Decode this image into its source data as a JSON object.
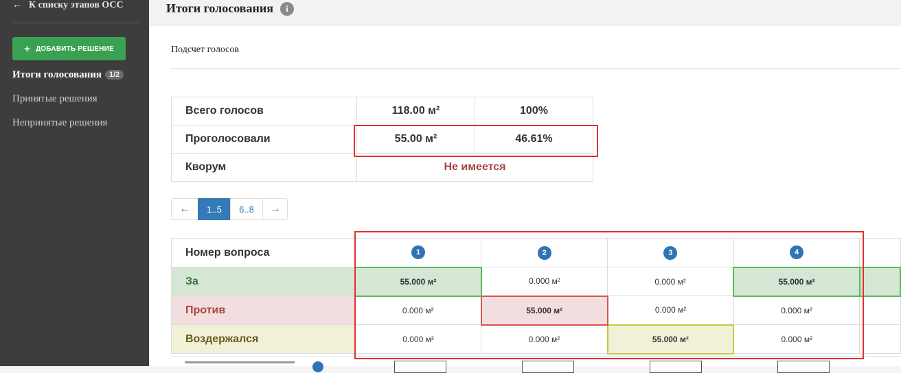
{
  "sidebar": {
    "back_arrow": "←",
    "back_label": "К списку этапов ОСС",
    "add_plus": "+",
    "add_label": "ДОБАВИТЬ РЕШЕНИЕ",
    "nav": [
      {
        "label": "Итоги голосования",
        "badge": "1/2",
        "active": true
      },
      {
        "label": "Принятые решения"
      },
      {
        "label": "Непринятые решения"
      }
    ]
  },
  "header": {
    "title": "Итоги голосования",
    "info_icon": "info-icon",
    "info_glyph": "i"
  },
  "section": {
    "subtitle": "Подсчет голосов"
  },
  "summary": {
    "rows": [
      {
        "label": "Всего голосов",
        "area": "118.00 м²",
        "percent": "100%"
      },
      {
        "label": "Проголосовали",
        "area": "55.00 м²",
        "percent": "46.61%"
      },
      {
        "label": "Кворум",
        "status": "Не имеется"
      }
    ],
    "quorum_color": "#a94442"
  },
  "pagination": {
    "prev": "←",
    "pages": [
      "1..5",
      "6..8"
    ],
    "active": "1..5",
    "next": "→"
  },
  "votes": {
    "header_label": "Номер вопроса",
    "question_numbers": [
      "1",
      "2",
      "3",
      "4"
    ],
    "rows": [
      {
        "label": "За",
        "values": [
          "55.000 м²",
          "0.000 м²",
          "0.000 м²",
          "55.000 м²"
        ]
      },
      {
        "label": "Против",
        "values": [
          "0.000 м²",
          "55.000 м²",
          "0.000 м²",
          "0.000 м²"
        ]
      },
      {
        "label": "Воздержался",
        "values": [
          "0.000 м²",
          "0.000 м²",
          "55.000 м²",
          "0.000 м²"
        ]
      }
    ],
    "colors": {
      "for": "#3c763d",
      "against": "#a94442",
      "abstain": "#6b5a1e",
      "question_badge": "#2f74b5"
    }
  },
  "annotation_color": "#e03131"
}
